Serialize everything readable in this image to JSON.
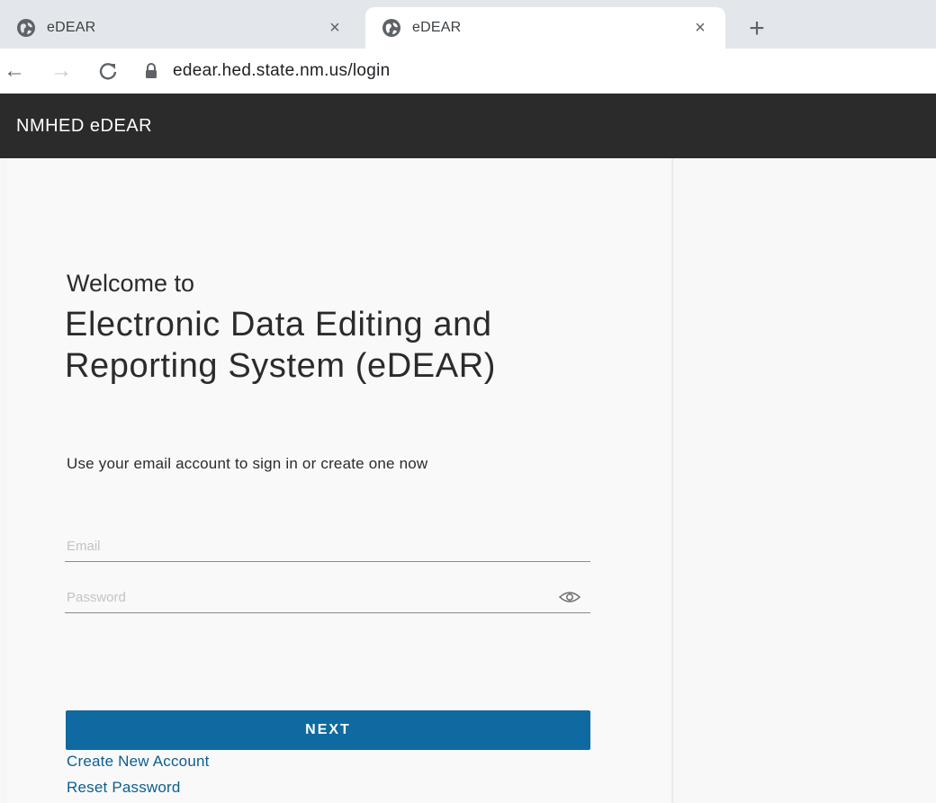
{
  "browser": {
    "tabs": [
      {
        "title": "eDEAR",
        "active": false,
        "close_glyph": "×",
        "icon": "globe-icon"
      },
      {
        "title": "eDEAR",
        "active": true,
        "close_glyph": "×",
        "icon": "globe-icon"
      }
    ],
    "new_tab_glyph": "+",
    "nav": {
      "back_glyph": "←",
      "forward_glyph": "→",
      "reload_glyph": "C"
    },
    "url": "edear.hed.state.nm.us/login"
  },
  "app": {
    "title": "NMHED eDEAR"
  },
  "login": {
    "welcome": "Welcome to",
    "system_title": "Electronic Data Editing and Reporting System (eDEAR)",
    "instructions": "Use your email account to sign in or create one now",
    "email_placeholder": "Email",
    "password_placeholder": "Password",
    "next_label": "NEXT",
    "create_account_label": "Create New Account",
    "reset_password_label": "Reset Password"
  },
  "colors": {
    "header_bg": "#2b2b2b",
    "primary_button": "#0e6aa0",
    "link": "#0d5e8f"
  }
}
